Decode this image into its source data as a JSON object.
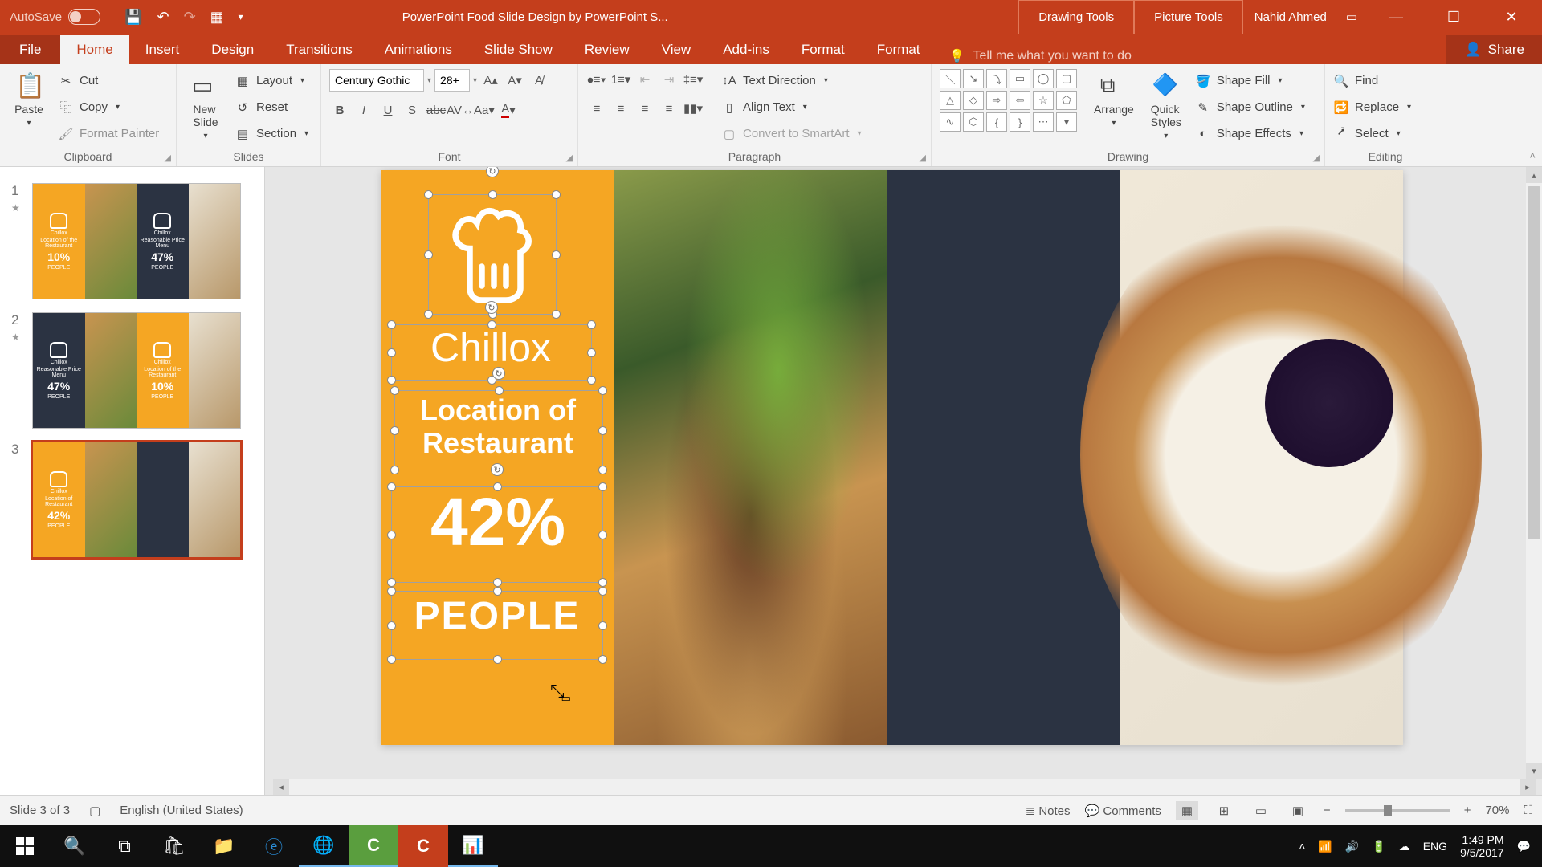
{
  "titlebar": {
    "autosave": "AutoSave",
    "title": "PowerPoint Food Slide Design by PowerPoint S...",
    "ctx1": "Drawing Tools",
    "ctx2": "Picture Tools",
    "user": "Nahid Ahmed"
  },
  "tabs": {
    "file": "File",
    "home": "Home",
    "insert": "Insert",
    "design": "Design",
    "transitions": "Transitions",
    "animations": "Animations",
    "slideshow": "Slide Show",
    "review": "Review",
    "view": "View",
    "addins": "Add-ins",
    "format1": "Format",
    "format2": "Format",
    "tellme": "Tell me what you want to do",
    "share": "Share"
  },
  "ribbon": {
    "clipboard": {
      "label": "Clipboard",
      "paste": "Paste",
      "cut": "Cut",
      "copy": "Copy",
      "fp": "Format Painter"
    },
    "slides": {
      "label": "Slides",
      "new": "New\nSlide",
      "layout": "Layout",
      "reset": "Reset",
      "section": "Section"
    },
    "font": {
      "label": "Font",
      "name": "Century Gothic",
      "size": "28+"
    },
    "paragraph": {
      "label": "Paragraph",
      "textdir": "Text Direction",
      "align": "Align Text",
      "smartart": "Convert to SmartArt"
    },
    "drawing": {
      "label": "Drawing",
      "arrange": "Arrange",
      "quick": "Quick\nStyles",
      "fill": "Shape Fill",
      "outline": "Shape Outline",
      "effects": "Shape Effects"
    },
    "editing": {
      "label": "Editing",
      "find": "Find",
      "replace": "Replace",
      "select": "Select"
    }
  },
  "thumbs": {
    "s1": {
      "t1": "Chillox",
      "t2": "Location of the Restaurant",
      "p1": "10%",
      "ppl": "PEOPLE",
      "t3": "Chillox",
      "t4": "Reasonable Price Menu",
      "p2": "47%"
    },
    "s2": {
      "t1": "Chillox",
      "t2": "Reasonable Price Menu",
      "p1": "47%",
      "ppl": "PEOPLE",
      "t3": "Chillox",
      "t4": "Location of the Restaurant",
      "p2": "10%"
    },
    "s3": {
      "t1": "Chillox",
      "t2": "Location of Restaurant",
      "p1": "42%",
      "ppl": "PEOPLE"
    }
  },
  "slide": {
    "title": "Chillox",
    "subtitle1": "Location of",
    "subtitle2": "Restaurant",
    "percent": "42%",
    "people": "PEOPLE"
  },
  "status": {
    "slide": "Slide 3 of 3",
    "lang": "English (United States)",
    "notes": "Notes",
    "comments": "Comments",
    "zoom": "70%"
  },
  "taskbar": {
    "lang": "ENG",
    "time": "1:49 PM",
    "date": "9/5/2017"
  }
}
